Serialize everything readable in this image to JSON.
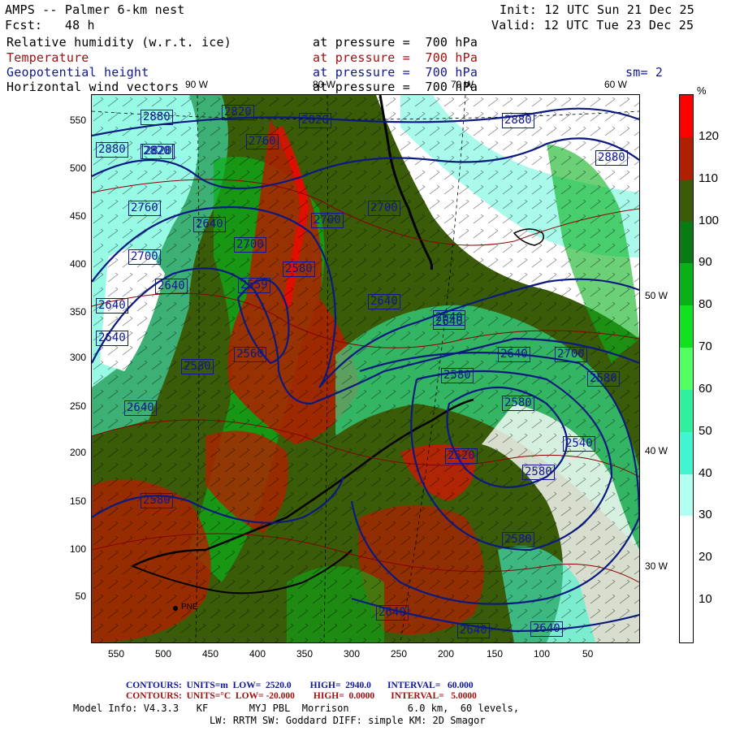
{
  "header": {
    "title": "AMPS -- Palmer 6-km nest",
    "init": "Init: 12 UTC Sun 21 Dec 25",
    "fcst": "Fcst:   48 h",
    "valid": "Valid: 12 UTC Tue 23 Dec 25"
  },
  "fields": [
    {
      "name": "Relative humidity (w.r.t. ice)",
      "level": "at pressure =  700 hPa",
      "color": "#000000"
    },
    {
      "name": "Temperature",
      "level": "at pressure =  700 hPa",
      "color": "#a01010"
    },
    {
      "name": "Geopotential height",
      "level": "at pressure =  700 hPa",
      "color": "#101890",
      "extra": "sm= 2"
    },
    {
      "name": "Horizontal wind vectors",
      "level": "at pressure =  700 hPa",
      "color": "#000000"
    }
  ],
  "axes": {
    "y_ticks": [
      "550",
      "500",
      "450",
      "400",
      "350",
      "300",
      "250",
      "200",
      "150",
      "100",
      "50"
    ],
    "x_ticks": [
      "550",
      "500",
      "450",
      "400",
      "350",
      "300",
      "250",
      "200",
      "150",
      "100",
      "50"
    ]
  },
  "longitude_labels": [
    "90 W",
    "80 W",
    "70 W",
    "60 W",
    "50 W",
    "40 W",
    "30 W"
  ],
  "legend": {
    "unit": "%",
    "labels": [
      "120",
      "110",
      "100",
      "90",
      "80",
      "70",
      "60",
      "50",
      "40",
      "30",
      "20",
      "10"
    ],
    "colors": [
      "#ff0000",
      "#b02000",
      "#3a5c08",
      "#0a7a14",
      "#0ab01a",
      "#10e020",
      "#50ff60",
      "#30f0a0",
      "#40f5d0",
      "#b0fff0",
      "#ffffff",
      "#ffffff",
      "#ffffff"
    ]
  },
  "contour_labels": [
    "2880",
    "2820",
    "2820",
    "2820",
    "2880",
    "2880",
    "2880",
    "2760",
    "2820",
    "2760",
    "2700",
    "2640",
    "2700",
    "2640",
    "2700",
    "2640",
    "2559",
    "2640",
    "2640",
    "2700",
    "2640",
    "2640",
    "2640",
    "2580",
    "2700",
    "2580",
    "2560",
    "2580",
    "2580",
    "2520",
    "2540",
    "2580",
    "2580",
    "2640",
    "2640",
    "2640",
    "2640",
    "2580",
    "2580"
  ],
  "footer": {
    "line1_label": "CONTOURS:",
    "line1_units": "UNITS=m",
    "line1_low": "LOW=  2520.0",
    "line1_high": "HIGH=  2940.0",
    "line1_interval": "INTERVAL=   60.000",
    "line2_label": "CONTOURS:",
    "line2_units": "UNITS=°C",
    "line2_low": "LOW= -20.000",
    "line2_high": "HIGH=  0.0000",
    "line2_interval": "INTERVAL=   5.0000",
    "model_info": "Model Info: V4.3.3   KF       MYJ PBL  Morrison          6.0 km,  60 levels,",
    "physics": "LW: RRTM SW: Goddard DIFF: simple KM: 2D Smagor"
  },
  "station": "PNE"
}
